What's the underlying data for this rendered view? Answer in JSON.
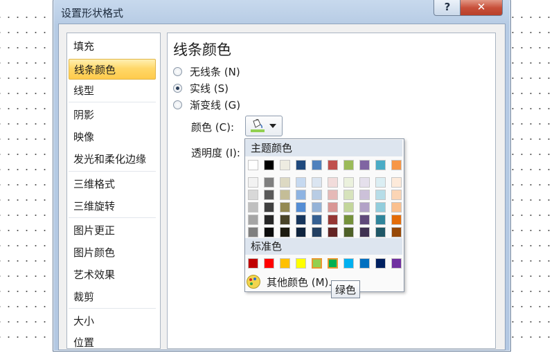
{
  "dialog": {
    "title": "设置形状格式",
    "help_label": "?",
    "close_label": "✕"
  },
  "nav": {
    "items": [
      {
        "label": "填充"
      },
      {
        "label": "线条颜色"
      },
      {
        "label": "线型"
      },
      {
        "label": "阴影"
      },
      {
        "label": "映像"
      },
      {
        "label": "发光和柔化边缘"
      },
      {
        "label": "三维格式"
      },
      {
        "label": "三维旋转"
      },
      {
        "label": "图片更正"
      },
      {
        "label": "图片颜色"
      },
      {
        "label": "艺术效果"
      },
      {
        "label": "裁剪"
      },
      {
        "label": "大小"
      },
      {
        "label": "位置"
      }
    ],
    "selected": "线条颜色"
  },
  "panel": {
    "title": "线条颜色",
    "options": [
      {
        "label": "无线条 (N)",
        "checked": false
      },
      {
        "label": "实线 (S)",
        "checked": true
      },
      {
        "label": "渐变线 (G)",
        "checked": false
      }
    ],
    "color_label": "颜色 (C):",
    "transparency_label": "透明度 (I):",
    "line_color_icon": "paint-bucket-icon",
    "current_color": "#92d050"
  },
  "popup": {
    "theme_header": "主题颜色",
    "standard_header": "标准色",
    "more_colors_label": "其他颜色 (M)...",
    "more_colors_icon": "palette-icon",
    "theme_colors": [
      "#ffffff",
      "#000000",
      "#eeece1",
      "#1f497d",
      "#4f81bd",
      "#c0504d",
      "#9bbb59",
      "#8064a2",
      "#4bacc6",
      "#f79646"
    ],
    "theme_shades": [
      [
        "#f2f2f2",
        "#7f7f7f",
        "#ddd9c3",
        "#c6d9f0",
        "#dbe5f1",
        "#f2dcdb",
        "#ebf1dd",
        "#e5e0ec",
        "#dbeef3",
        "#fdeada"
      ],
      [
        "#d8d8d8",
        "#595959",
        "#c4bd97",
        "#8db3e2",
        "#b8cce4",
        "#e5b9b7",
        "#d7e3bc",
        "#ccc1d9",
        "#b7dde8",
        "#fbd5b5"
      ],
      [
        "#bfbfbf",
        "#3f3f3f",
        "#938953",
        "#548dd4",
        "#95b3d7",
        "#d99694",
        "#c3d69b",
        "#b2a2c7",
        "#92cddc",
        "#fac08f"
      ],
      [
        "#a5a5a5",
        "#262626",
        "#494429",
        "#17365d",
        "#366092",
        "#953734",
        "#76923c",
        "#5f497a",
        "#31859b",
        "#e36c09"
      ],
      [
        "#7f7f7f",
        "#0c0c0c",
        "#1d1b10",
        "#0f243e",
        "#244061",
        "#632423",
        "#4f6128",
        "#3f3151",
        "#205867",
        "#974806"
      ]
    ],
    "standard_colors": [
      "#c00000",
      "#ff0000",
      "#ffc000",
      "#ffff00",
      "#92d050",
      "#00b050",
      "#00b0f0",
      "#0070c0",
      "#002060",
      "#7030a0"
    ],
    "highlighted_standard": [
      "#92d050",
      "#00b050"
    ],
    "tooltip": "绿色"
  }
}
